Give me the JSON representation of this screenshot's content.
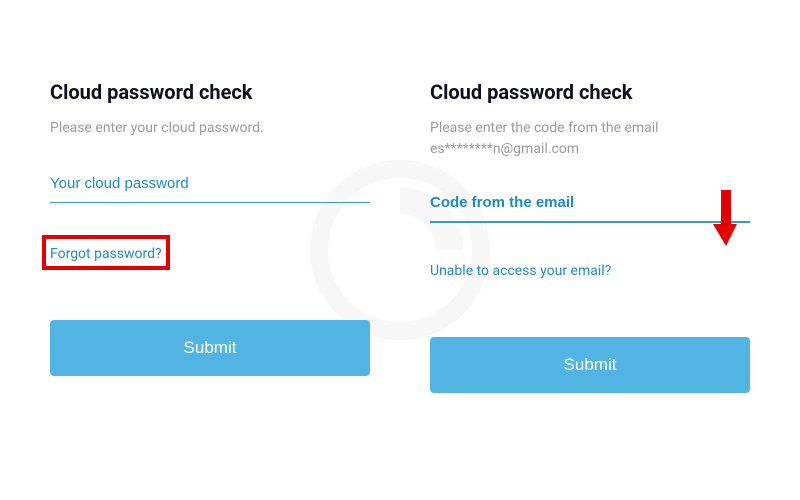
{
  "left_panel": {
    "title": "Cloud password check",
    "subtitle": "Please enter your cloud password.",
    "input_placeholder": "Your cloud password",
    "link_text": "Forgot password?",
    "submit_label": "Submit"
  },
  "right_panel": {
    "title": "Cloud password check",
    "subtitle_line1": "Please enter the code from the email",
    "subtitle_line2": "es********n@gmail.com",
    "input_placeholder": "Code from the email",
    "link_text": "Unable to access your email?",
    "submit_label": "Submit"
  }
}
